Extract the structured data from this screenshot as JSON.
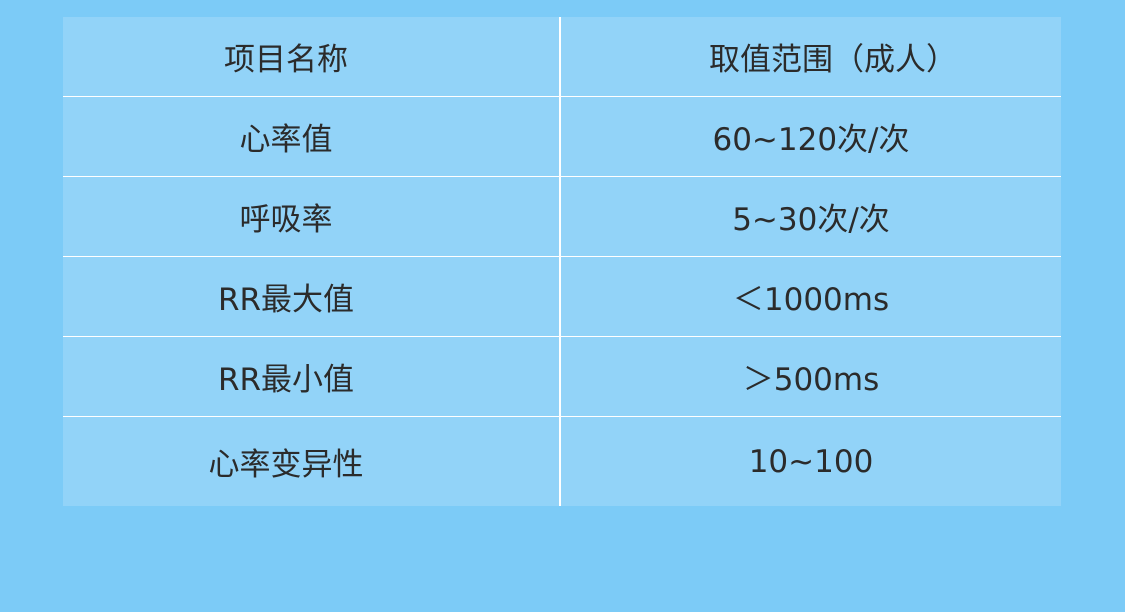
{
  "table": {
    "headers": [
      "项目名称",
      "取值范围（成人）"
    ],
    "rows": [
      [
        "心率值",
        "60~120次/次"
      ],
      [
        "呼吸率",
        "5~30次/次"
      ],
      [
        "RR最大值",
        "＜1000ms"
      ],
      [
        "RR最小值",
        "＞500ms"
      ],
      [
        "心率变异性",
        "10~100"
      ]
    ]
  }
}
